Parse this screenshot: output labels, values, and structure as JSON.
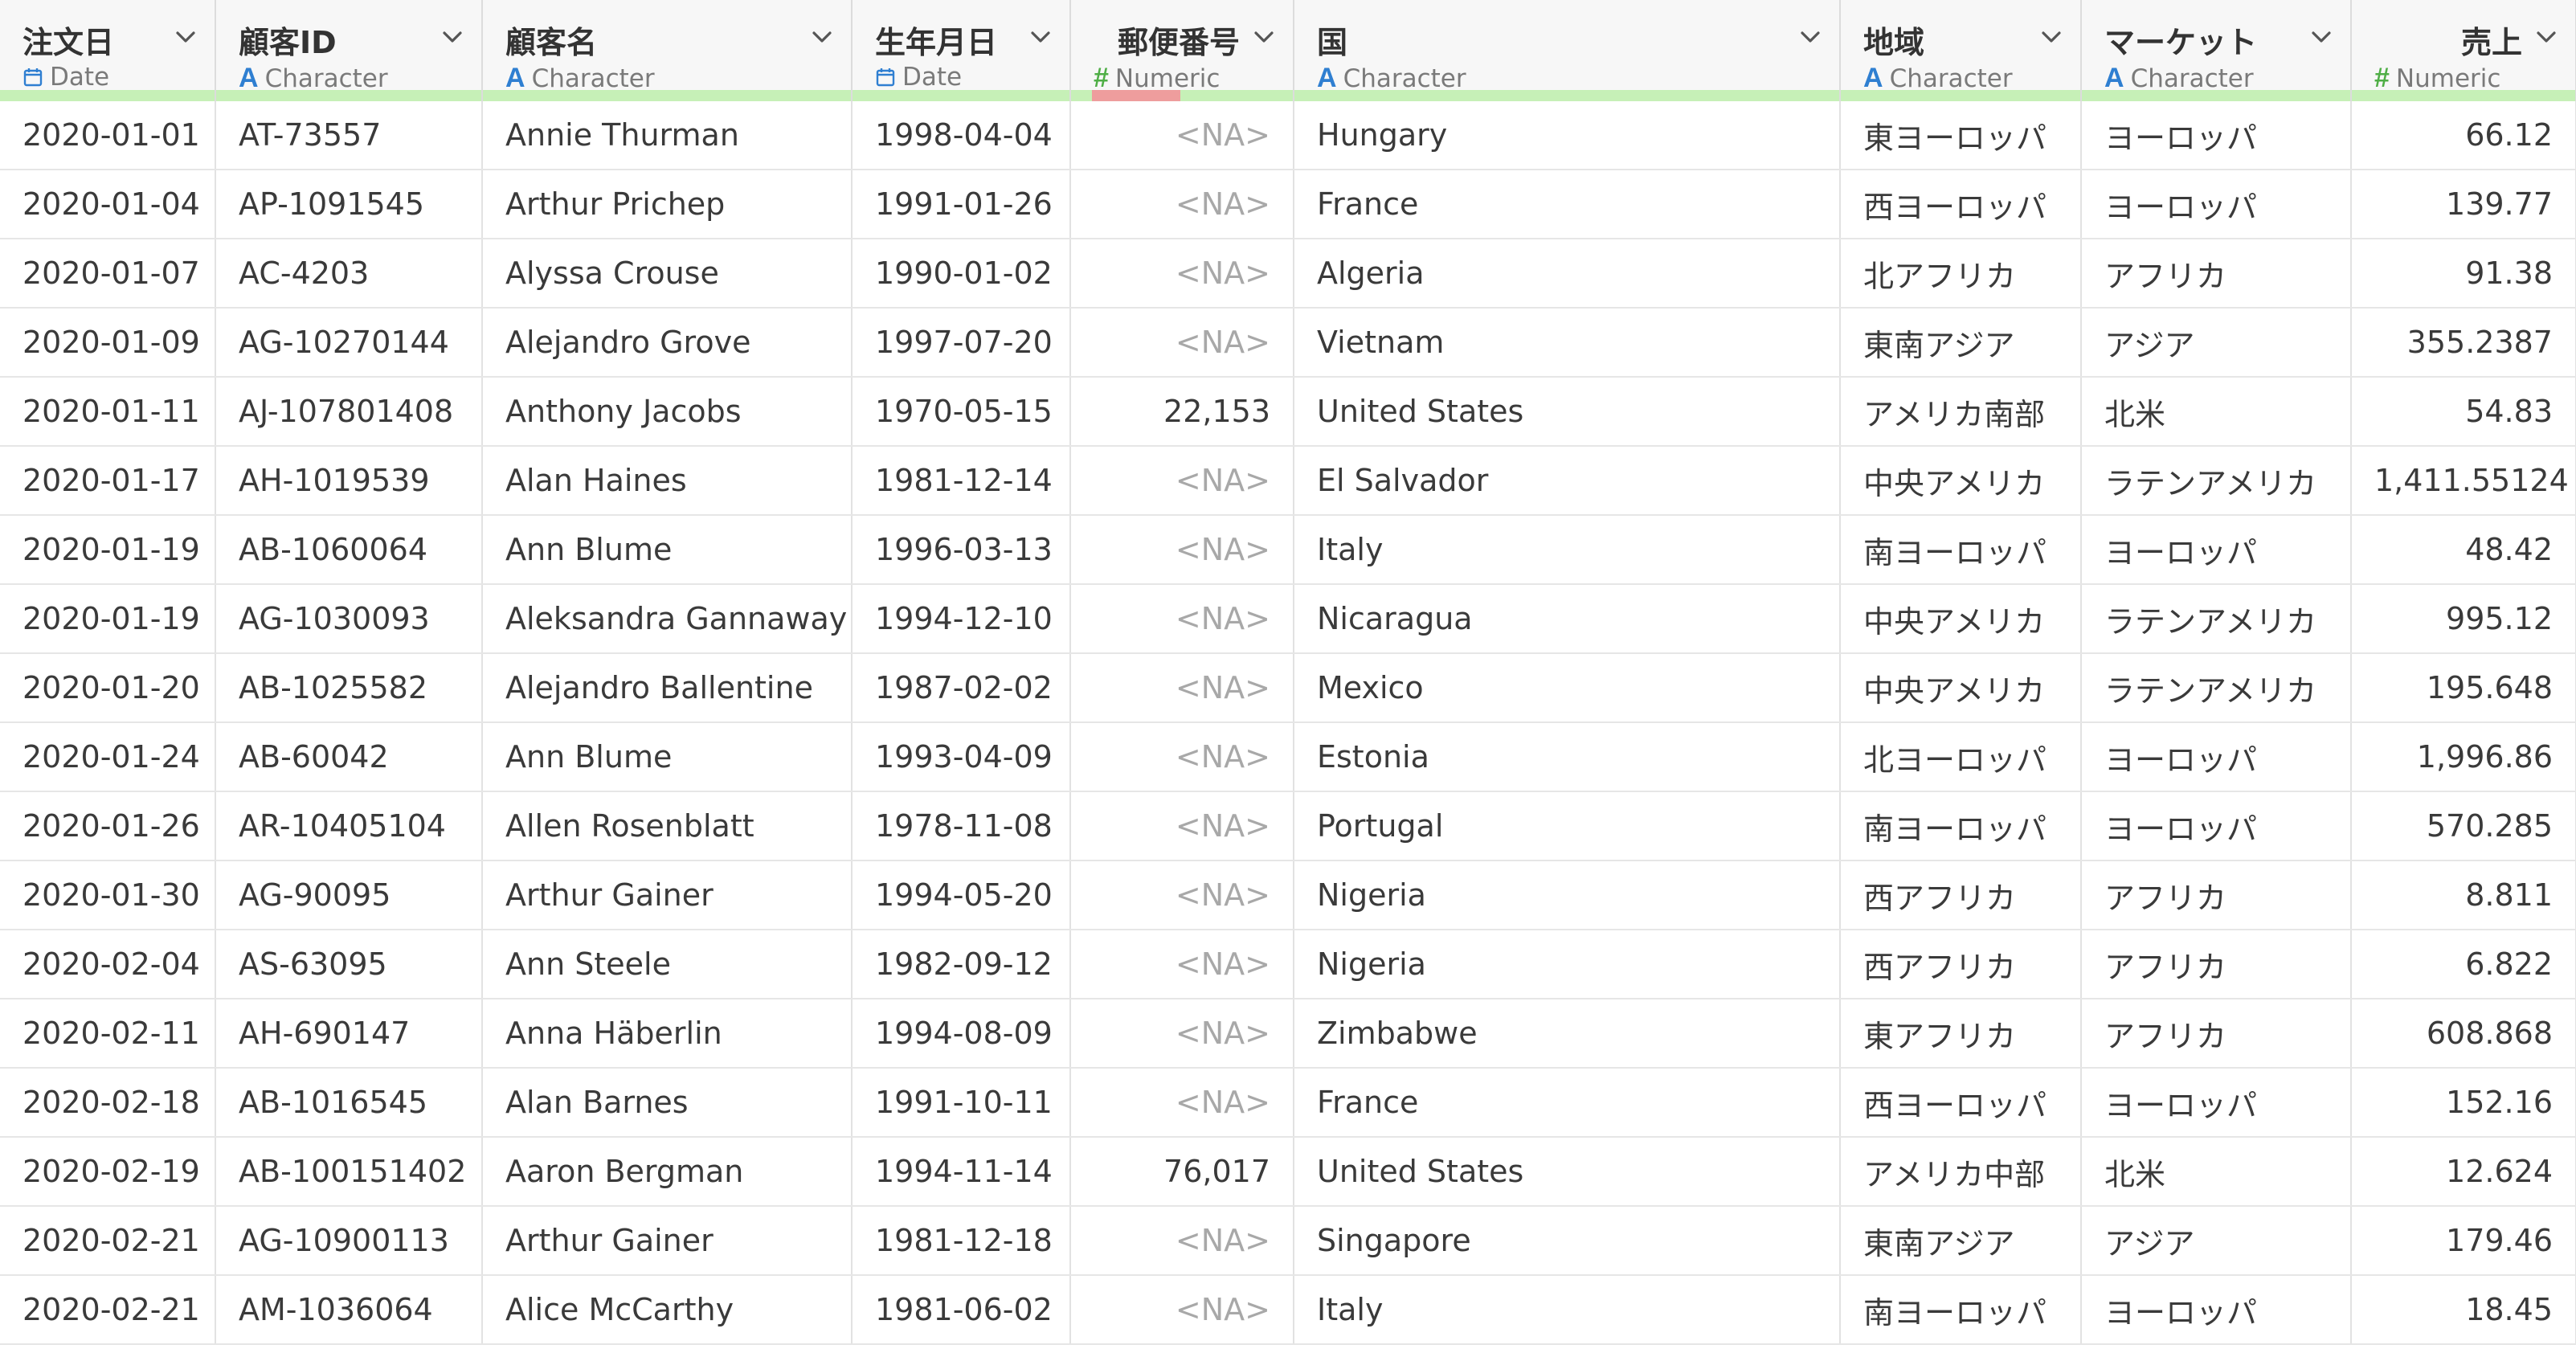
{
  "columns": [
    {
      "name": "注文日",
      "type": "Date",
      "type_icon": "calendar-icon",
      "align": "left"
    },
    {
      "name": "顧客ID",
      "type": "Character",
      "type_icon": "character-a-icon",
      "align": "left"
    },
    {
      "name": "顧客名",
      "type": "Character",
      "type_icon": "character-a-icon",
      "align": "left"
    },
    {
      "name": "生年月日",
      "type": "Date",
      "type_icon": "calendar-icon",
      "align": "left"
    },
    {
      "name": "郵便番号",
      "type": "Numeric",
      "type_icon": "numeric-hash-icon",
      "align": "right"
    },
    {
      "name": "国",
      "type": "Character",
      "type_icon": "character-a-icon",
      "align": "left"
    },
    {
      "name": "地域",
      "type": "Character",
      "type_icon": "character-a-icon",
      "align": "left"
    },
    {
      "name": "マーケット",
      "type": "Character",
      "type_icon": "character-a-icon",
      "align": "left"
    },
    {
      "name": "売上",
      "type": "Numeric",
      "type_icon": "numeric-hash-icon",
      "align": "right"
    }
  ],
  "type_icon_glyphs": {
    "character-a-icon": "A",
    "numeric-hash-icon": "#"
  },
  "colors": {
    "valid_bar": "#c6f0b7",
    "missing_bar": "#ee9d9d",
    "type_A": "#2f7fd1",
    "type_hash": "#4fae46"
  },
  "rows": [
    [
      "2020-01-01",
      "AT-73557",
      "Annie Thurman",
      "1998-04-04",
      "<NA>",
      "Hungary",
      "東ヨーロッパ",
      "ヨーロッパ",
      "66.12"
    ],
    [
      "2020-01-04",
      "AP-1091545",
      "Arthur Prichep",
      "1991-01-26",
      "<NA>",
      "France",
      "西ヨーロッパ",
      "ヨーロッパ",
      "139.77"
    ],
    [
      "2020-01-07",
      "AC-4203",
      "Alyssa Crouse",
      "1990-01-02",
      "<NA>",
      "Algeria",
      "北アフリカ",
      "アフリカ",
      "91.38"
    ],
    [
      "2020-01-09",
      "AG-10270144",
      "Alejandro Grove",
      "1997-07-20",
      "<NA>",
      "Vietnam",
      "東南アジア",
      "アジア",
      "355.2387"
    ],
    [
      "2020-01-11",
      "AJ-107801408",
      "Anthony Jacobs",
      "1970-05-15",
      "22,153",
      "United States",
      "アメリカ南部",
      "北米",
      "54.83"
    ],
    [
      "2020-01-17",
      "AH-1019539",
      "Alan Haines",
      "1981-12-14",
      "<NA>",
      "El Salvador",
      "中央アメリカ",
      "ラテンアメリカ",
      "1,411.55124"
    ],
    [
      "2020-01-19",
      "AB-1060064",
      "Ann Blume",
      "1996-03-13",
      "<NA>",
      "Italy",
      "南ヨーロッパ",
      "ヨーロッパ",
      "48.42"
    ],
    [
      "2020-01-19",
      "AG-1030093",
      "Aleksandra Gannaway",
      "1994-12-10",
      "<NA>",
      "Nicaragua",
      "中央アメリカ",
      "ラテンアメリカ",
      "995.12"
    ],
    [
      "2020-01-20",
      "AB-1025582",
      "Alejandro Ballentine",
      "1987-02-02",
      "<NA>",
      "Mexico",
      "中央アメリカ",
      "ラテンアメリカ",
      "195.648"
    ],
    [
      "2020-01-24",
      "AB-60042",
      "Ann Blume",
      "1993-04-09",
      "<NA>",
      "Estonia",
      "北ヨーロッパ",
      "ヨーロッパ",
      "1,996.86"
    ],
    [
      "2020-01-26",
      "AR-10405104",
      "Allen Rosenblatt",
      "1978-11-08",
      "<NA>",
      "Portugal",
      "南ヨーロッパ",
      "ヨーロッパ",
      "570.285"
    ],
    [
      "2020-01-30",
      "AG-90095",
      "Arthur Gainer",
      "1994-05-20",
      "<NA>",
      "Nigeria",
      "西アフリカ",
      "アフリカ",
      "8.811"
    ],
    [
      "2020-02-04",
      "AS-63095",
      "Ann Steele",
      "1982-09-12",
      "<NA>",
      "Nigeria",
      "西アフリカ",
      "アフリカ",
      "6.822"
    ],
    [
      "2020-02-11",
      "AH-690147",
      "Anna Häberlin",
      "1994-08-09",
      "<NA>",
      "Zimbabwe",
      "東アフリカ",
      "アフリカ",
      "608.868"
    ],
    [
      "2020-02-18",
      "AB-1016545",
      "Alan Barnes",
      "1991-10-11",
      "<NA>",
      "France",
      "西ヨーロッパ",
      "ヨーロッパ",
      "152.16"
    ],
    [
      "2020-02-19",
      "AB-100151402",
      "Aaron Bergman",
      "1994-11-14",
      "76,017",
      "United States",
      "アメリカ中部",
      "北米",
      "12.624"
    ],
    [
      "2020-02-21",
      "AG-10900113",
      "Arthur Gainer",
      "1981-12-18",
      "<NA>",
      "Singapore",
      "東南アジア",
      "アジア",
      "179.46"
    ],
    [
      "2020-02-21",
      "AM-1036064",
      "Alice McCarthy",
      "1981-06-02",
      "<NA>",
      "Italy",
      "南ヨーロッパ",
      "ヨーロッパ",
      "18.45"
    ]
  ]
}
